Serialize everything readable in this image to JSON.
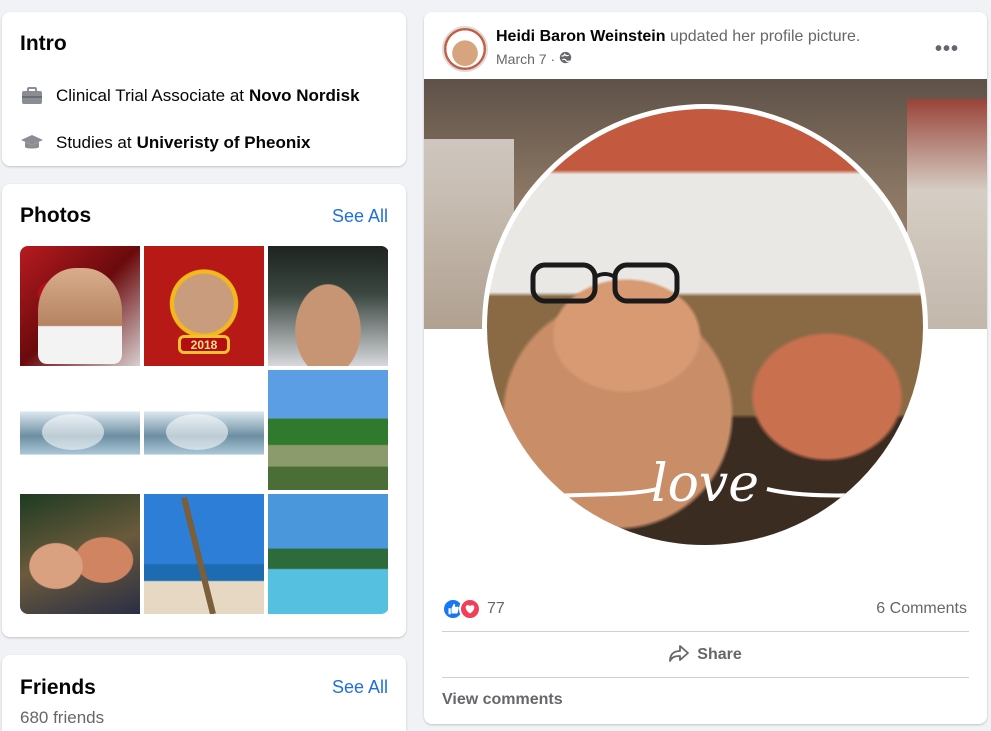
{
  "colors": {
    "link": "#216fdb",
    "secondary_text": "#65676b",
    "like_blue": "#1877f2",
    "love_red": "#f33e58",
    "page_bg": "#f0f2f5"
  },
  "intro": {
    "title": "Intro",
    "work": {
      "icon": "briefcase-icon",
      "prefix": "Clinical Trial Associate at",
      "org": "Novo Nordisk"
    },
    "education": {
      "icon": "graduation-cap-icon",
      "prefix": "Studies at",
      "org": "Univeristy of Pheonix"
    }
  },
  "photos": {
    "title": "Photos",
    "see_all": "See All",
    "items": [
      {
        "desc": "couple-heart-frame"
      },
      {
        "desc": "couple-new-year-frame",
        "banner": "2018"
      },
      {
        "desc": "couple-selfie"
      },
      {
        "desc": "beach-water-graphic-1"
      },
      {
        "desc": "beach-water-graphic-2"
      },
      {
        "desc": "palm-trees-resort"
      },
      {
        "desc": "couple-selfie-outdoor"
      },
      {
        "desc": "beach-palm-tree"
      },
      {
        "desc": "resort-pool"
      }
    ]
  },
  "friends": {
    "title": "Friends",
    "see_all": "See All",
    "count": "680 friends"
  },
  "post": {
    "author": "Heidi Baron Weinstein",
    "action": "updated her profile picture.",
    "date": "March 7 ·",
    "privacy_icon": "globe-icon",
    "more": "•••",
    "image_overlay_text": "love",
    "reaction_count": "77",
    "comment_count": "6 Comments",
    "share_label": "Share",
    "view_comments": "View comments"
  }
}
